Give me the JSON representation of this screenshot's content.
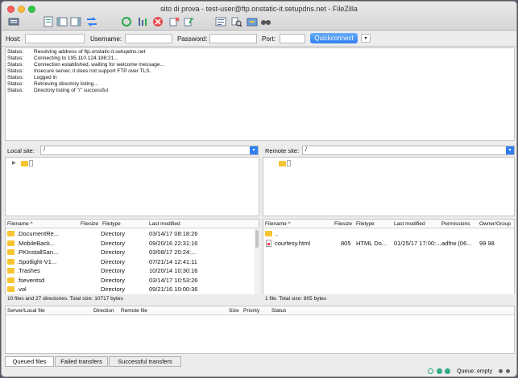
{
  "window": {
    "title": "sito di prova - test-user@ftp.onstatic-it.setupdns.net - FileZilla"
  },
  "toolbar": {
    "icons": [
      "site-manager-icon",
      "toggle-log-icon",
      "toggle-local-tree-icon",
      "toggle-remote-tree-icon",
      "transfer-queue-icon",
      "refresh-icon",
      "process-queue-icon",
      "cancel-icon",
      "disconnect-icon",
      "reconnect-icon",
      "directory-filter-icon",
      "compare-icon",
      "sync-browse-icon",
      "search-icon"
    ]
  },
  "quickconnect": {
    "host_label": "Host:",
    "host_value": "",
    "username_label": "Username:",
    "username_value": "",
    "password_label": "Password:",
    "password_value": "",
    "port_label": "Port:",
    "port_value": "",
    "button_label": "Quickconnect",
    "dropdown_glyph": "▾"
  },
  "log": [
    {
      "type": "Status:",
      "message": "Resolving address of ftp.onstatic-it.setupdns.net"
    },
    {
      "type": "Status:",
      "message": "Connecting to 195.110.124.188:21..."
    },
    {
      "type": "Status:",
      "message": "Connection established, waiting for welcome message..."
    },
    {
      "type": "Status:",
      "message": "Insecure server, it does not support FTP over TLS."
    },
    {
      "type": "Status:",
      "message": "Logged in"
    },
    {
      "type": "Status:",
      "message": "Retrieving directory listing..."
    },
    {
      "type": "Status:",
      "message": "Directory listing of \"/\" successful"
    }
  ],
  "local": {
    "site_label": "Local site:",
    "path": "/",
    "columns": {
      "filename": "Filename",
      "filesize": "Filesize",
      "filetype": "Filetype",
      "modified": "Last modified"
    },
    "files": [
      {
        "name": ".DocumentRe...",
        "size": "",
        "type": "Directory",
        "modified": "03/14/17 08:18:26"
      },
      {
        "name": ".MobileBack...",
        "size": "",
        "type": "Directory",
        "modified": "09/20/16 22:31:16"
      },
      {
        "name": ".PKInstallSan...",
        "size": "",
        "type": "Directory",
        "modified": "03/08/17 20:24:..."
      },
      {
        "name": ".Spotlight-V1...",
        "size": "",
        "type": "Directory",
        "modified": "07/21/14 12:41:11"
      },
      {
        "name": ".Trashes",
        "size": "",
        "type": "Directory",
        "modified": "10/20/14 10:30:16"
      },
      {
        "name": ".fseventsd",
        "size": "",
        "type": "Directory",
        "modified": "03/14/17 10:53:26"
      },
      {
        "name": ".vol",
        "size": "",
        "type": "Directory",
        "modified": "09/21/16 10:00:36"
      }
    ],
    "status": "10 files and 27 directories. Total size: 10717 bytes"
  },
  "remote": {
    "site_label": "Remote site:",
    "path": "/",
    "columns": {
      "filename": "Filename",
      "filesize": "Filesize",
      "filetype": "Filetype",
      "modified": "Last modified",
      "permissions": "Permissions",
      "owner": "Owner/Group"
    },
    "files": [
      {
        "name": "..",
        "size": "",
        "type": "",
        "modified": "",
        "permissions": "",
        "owner": ""
      },
      {
        "name": "courtesy.html",
        "size": "805",
        "type": "HTML Do...",
        "modified": "01/25/17 17:00:...",
        "permissions": "adfrw (06...",
        "owner": "99 98"
      }
    ],
    "status": "1 file. Total size: 805 bytes"
  },
  "queue": {
    "columns": {
      "server": "Server/Local file",
      "direction": "Direction",
      "remote": "Remote file",
      "size": "Size",
      "priority": "Priority",
      "status": "Status"
    }
  },
  "tabs": {
    "queued": "Queued files",
    "failed": "Failed transfers",
    "successful": "Successful transfers"
  },
  "statusbar": {
    "queue": "Queue: empty"
  },
  "colors": {
    "accent": "#2f7ff2",
    "folder": "#f7c531"
  }
}
